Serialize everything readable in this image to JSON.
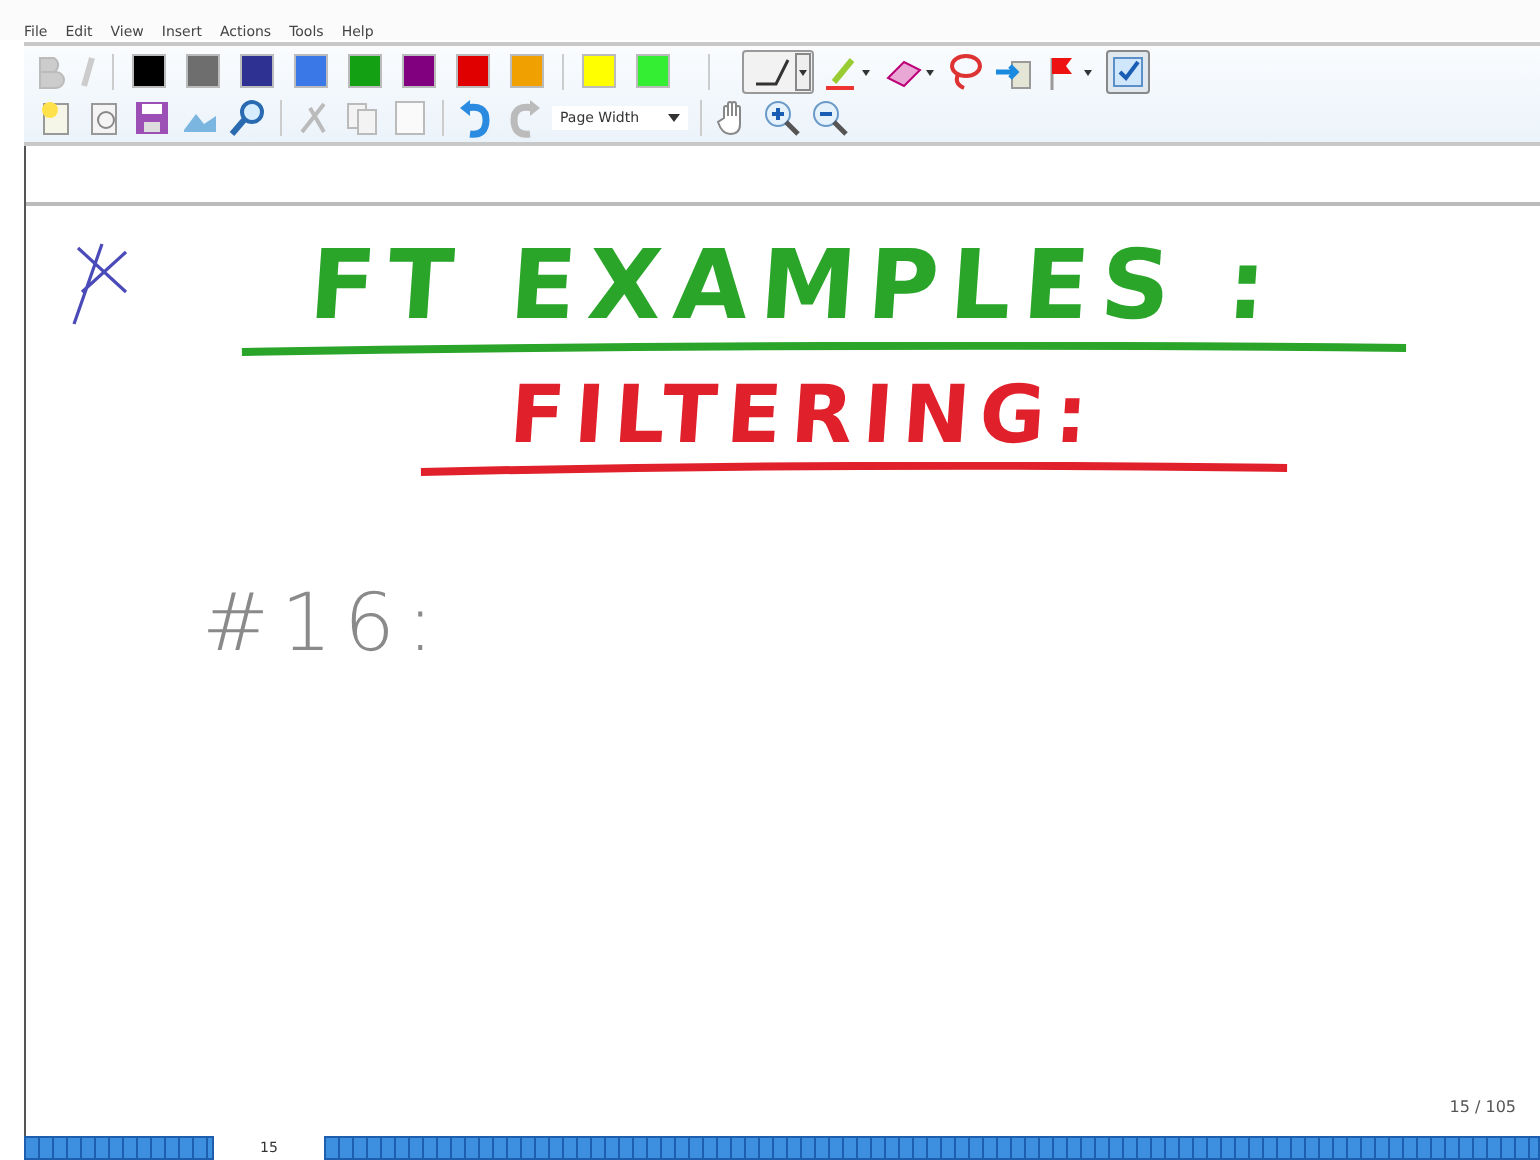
{
  "menu": [
    "File",
    "Edit",
    "View",
    "Insert",
    "Actions",
    "Tools",
    "Help"
  ],
  "swatches": [
    {
      "color": "#000000"
    },
    {
      "color": "#6e6e6e"
    },
    {
      "color": "#2e3192"
    },
    {
      "color": "#3a78e8"
    },
    {
      "color": "#13a013"
    },
    {
      "color": "#800080"
    },
    {
      "color": "#e00000"
    },
    {
      "color": "#f0a000"
    },
    {
      "color": "#ffff00"
    },
    {
      "color": "#33ee33"
    }
  ],
  "zoom": {
    "value": "Page Width"
  },
  "ink": [
    {
      "kind": "title",
      "text": "FT EXAMPLES :",
      "color": "#2aa52a"
    },
    {
      "kind": "title",
      "text": "FILTERING:",
      "color": "#e0202a"
    },
    {
      "kind": "note",
      "text": "#16:",
      "color": "#8a8a8a"
    }
  ],
  "page_counter": "15 / 105",
  "page_strip": {
    "label": "15"
  }
}
